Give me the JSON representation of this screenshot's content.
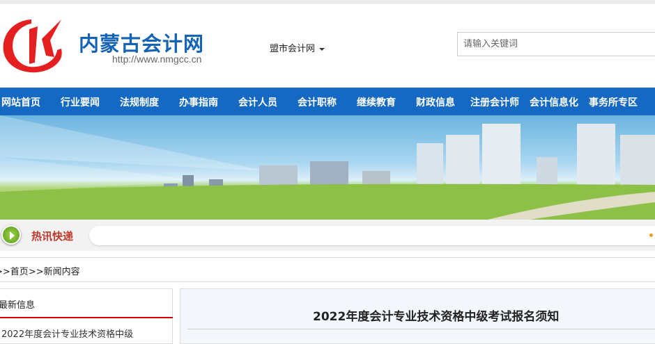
{
  "header": {
    "logo_title": "内蒙古会计网",
    "logo_url": "http://www.nmgcc.cn",
    "city_select": "盟市会计网",
    "search_placeholder": "请输入关键词"
  },
  "nav": [
    "网站首页",
    "行业要闻",
    "法规制度",
    "办事指南",
    "会计人员",
    "会计职称",
    "继续教育",
    "财政信息",
    "注册会计师",
    "会计信息化",
    "事务所专区"
  ],
  "hot": {
    "label": "热讯快递"
  },
  "breadcrumb": {
    "sep1": ">>",
    "home": "首页",
    "sep2": ">>",
    "current": "新闻内容"
  },
  "sidebar": {
    "title": "最新信息",
    "items": [
      "2022年度会计专业技术资格中级"
    ]
  },
  "article": {
    "title": "2022年度会计专业技术资格中级考试报名须知"
  },
  "colors": {
    "nav": "#1569c2",
    "logo_red": "#e41f1f",
    "logo_blue": "#1463b5",
    "accent_red": "#d40000"
  }
}
